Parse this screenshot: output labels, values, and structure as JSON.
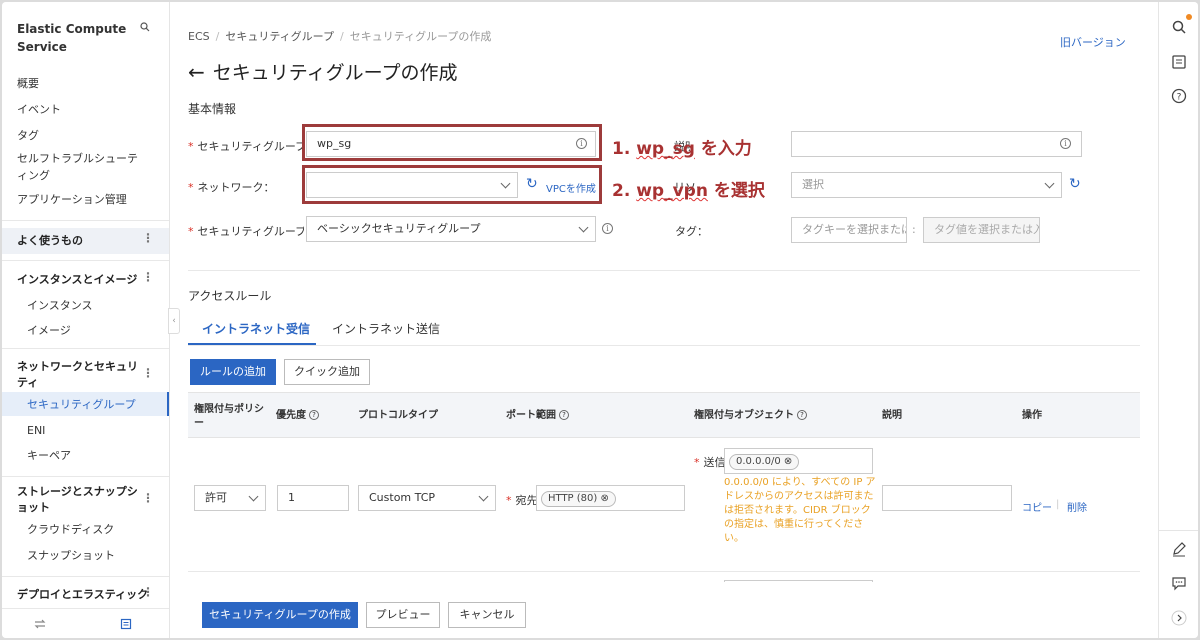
{
  "sidebar": {
    "title": "Elastic Compute Service",
    "items": {
      "overview": "概要",
      "events": "イベント",
      "tags": "タグ",
      "troubleshooting": "セルフトラブルシューティング",
      "app_management": "アプリケーション管理"
    },
    "groups": {
      "favorites": "よく使うもの",
      "instances_images": "インスタンスとイメージ",
      "network_security": "ネットワークとセキュリティ",
      "storage_snapshots": "ストレージとスナップショット",
      "deploy_elastic": "デプロイとエラスティック"
    },
    "sub_items": {
      "instances": "インスタンス",
      "images": "イメージ",
      "security_groups": "セキュリティグループ",
      "eni": "ENI",
      "keypairs": "キーペア",
      "cloud_disks": "クラウドディスク",
      "snapshots": "スナップショット"
    }
  },
  "header": {
    "breadcrumb": [
      "ECS",
      "セキュリティグループ",
      "セキュリティグループの作成"
    ],
    "old_version": "旧バージョン",
    "title": "セキュリティグループの作成"
  },
  "basic": {
    "section": "基本情報",
    "name_label": "セキュリティグループ名",
    "name_value": "wp_sg",
    "desc_label": "説明",
    "network_label": "ネットワーク：",
    "network_value": "",
    "create_vpc": "VPCを作成",
    "rg_label": "リソースグループ",
    "rg_placeholder": "選択",
    "type_label": "セキュリティグループタイプ",
    "type_value": "ベーシックセキュリティグループ",
    "tag_label": "タグ：",
    "tag_key_placeholder": "タグキーを選択または",
    "tag_value_placeholder": "タグ値を選択または入"
  },
  "annotations": {
    "a1_prefix": "1.",
    "a1_key": "wp_sg",
    "a1_suffix": "を入力",
    "a2_prefix": "2.",
    "a2_key": "wp_vpn",
    "a2_suffix": "を選択"
  },
  "access": {
    "section": "アクセスルール",
    "tabs": [
      "イントラネット受信",
      "イントラネット送信"
    ],
    "add_rule": "ルールの追加",
    "quick_add": "クイック追加",
    "columns": [
      "権限付与ポリシー",
      "優先度",
      "プロトコルタイプ",
      "ポート範囲",
      "権限付与オブジェクト",
      "説明",
      "操作"
    ],
    "row": {
      "policy": "許可",
      "priority": "1",
      "protocol": "Custom TCP",
      "dest_label": "宛先：",
      "dest_value": "HTTP (80)",
      "source_label": "送信元：",
      "source_value": "0.0.0.0/0",
      "warning": "0.0.0.0/0 により、すべての IP アドレスからのアクセスは許可または拒否されます。CIDR ブロックの指定は、慎重に行ってください。",
      "copy": "コピー",
      "delete": "削除"
    }
  },
  "footer": {
    "create": "セキュリティグループの作成",
    "preview": "プレビュー",
    "cancel": "キャンセル"
  },
  "colors": {
    "primary": "#2b66c3",
    "annotation": "#9d3b3b",
    "warning": "#e9a124"
  }
}
